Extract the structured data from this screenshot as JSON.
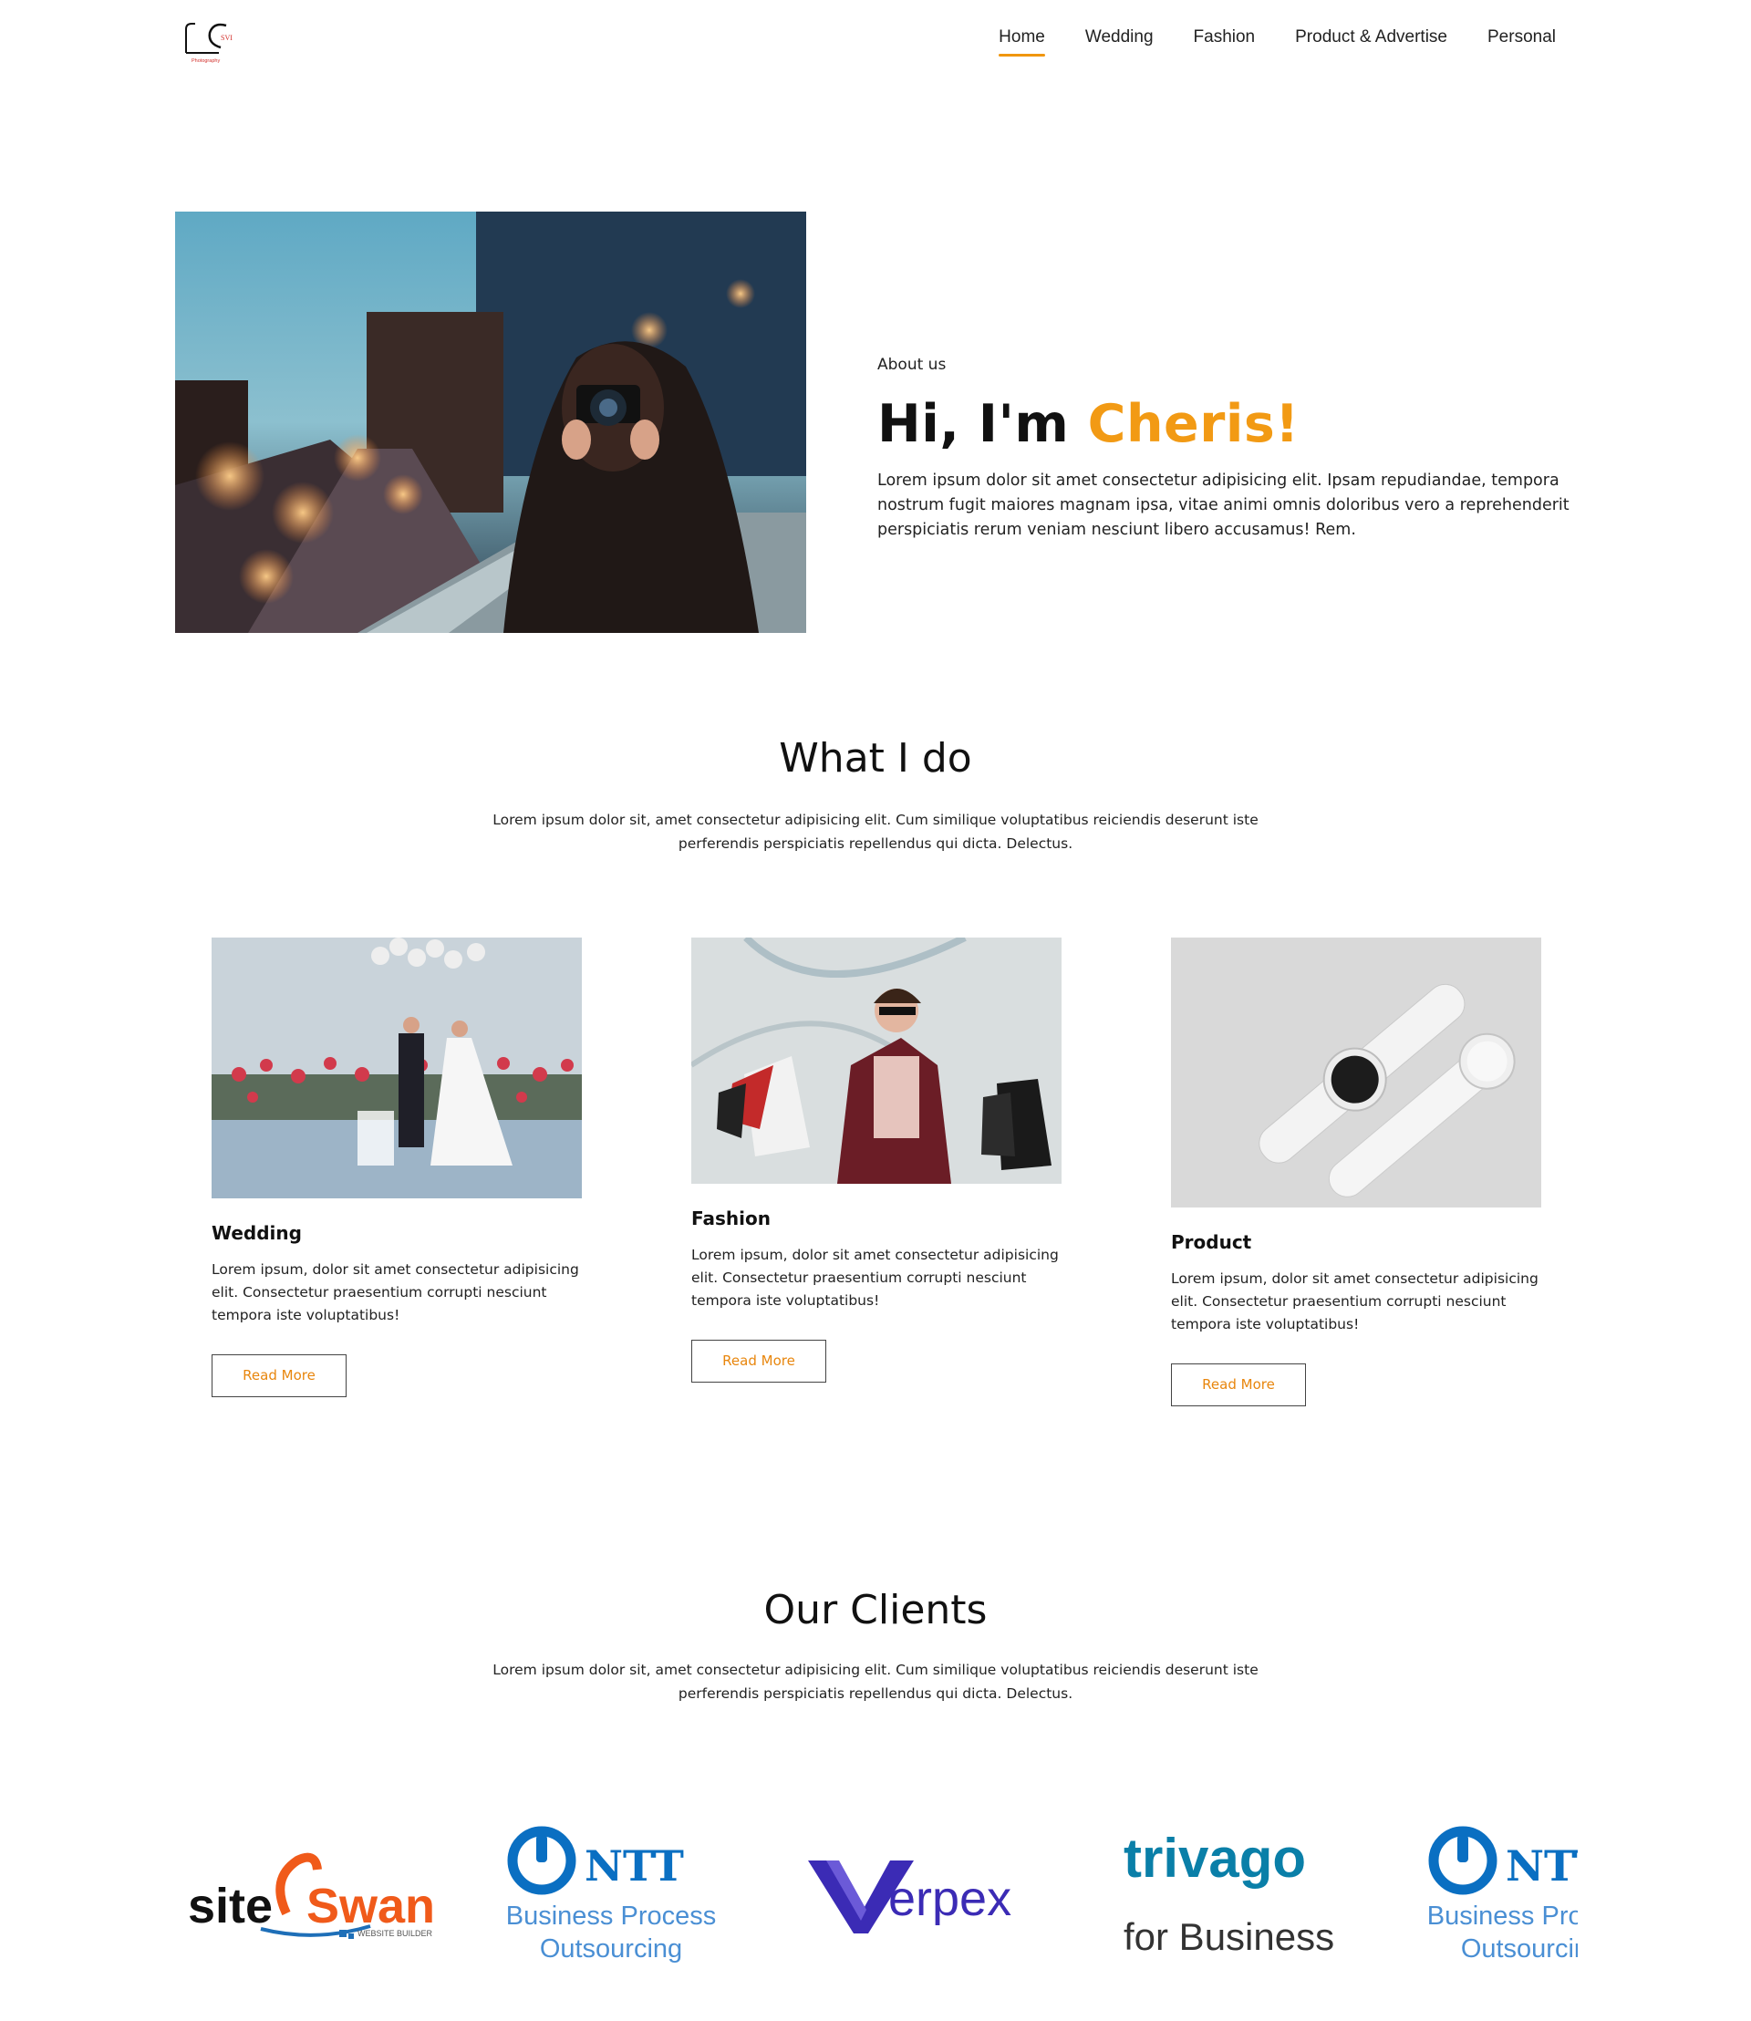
{
  "nav": {
    "items": [
      "Home",
      "Wedding",
      "Fashion",
      "Product & Advertise",
      "Personal"
    ],
    "active": "Home"
  },
  "logo": {
    "text": "SVI",
    "sub": "Photography"
  },
  "about": {
    "eyebrow": "About us",
    "heading_prefix": "Hi, I'm ",
    "heading_accent": "Cheris!",
    "body": "Lorem ipsum dolor sit amet consectetur adipisicing elit. Ipsam repudiandae, tempora nostrum fugit maiores magnam ipsa, vitae animi omnis doloribus vero a reprehenderit perspiciatis rerum veniam nesciunt libero accusamus! Rem."
  },
  "what_i_do": {
    "title": "What I do",
    "desc": "Lorem ipsum dolor sit, amet consectetur adipisicing elit. Cum similique voluptatibus reiciendis deserunt iste perferendis perspiciatis repellendus qui dicta. Delectus."
  },
  "cards": [
    {
      "title": "Wedding",
      "body": "Lorem ipsum, dolor sit amet consectetur adipisicing elit. Consectetur praesentium corrupti nesciunt tempora iste voluptatibus!",
      "button": "Read More"
    },
    {
      "title": "Fashion",
      "body": "Lorem ipsum, dolor sit amet consectetur adipisicing elit. Consectetur praesentium corrupti nesciunt tempora iste voluptatibus!",
      "button": "Read More"
    },
    {
      "title": "Product",
      "body": "Lorem ipsum, dolor sit amet consectetur adipisicing elit. Consectetur praesentium corrupti nesciunt tempora iste voluptatibus!",
      "button": "Read More"
    }
  ],
  "clients": {
    "title": "Our Clients",
    "desc": "Lorem ipsum dolor sit, amet consectetur adipisicing elit. Cum similique voluptatibus reiciendis deserunt iste perferendis perspiciatis repellendus qui dicta. Delectus.",
    "logos": [
      {
        "name": "siteSwan",
        "line1": "site",
        "line2": "Swan",
        "tag": "WEBSITE BUILDER"
      },
      {
        "name": "NTT",
        "brand": "NTT",
        "line1": "Business Process",
        "line2": "Outsourcing"
      },
      {
        "name": "Verpex",
        "brand": "erpex"
      },
      {
        "name": "trivago",
        "brand": "trivago",
        "line2": "for Business"
      },
      {
        "name": "NTT",
        "brand": "NTT",
        "line1": "Business Process",
        "line2": "Outsourcing"
      }
    ]
  },
  "colors": {
    "accent": "#f29a14",
    "ntt_blue": "#0a6fc2",
    "verpex_purple": "#3b2bb5",
    "swan_orange": "#f05a1a"
  }
}
